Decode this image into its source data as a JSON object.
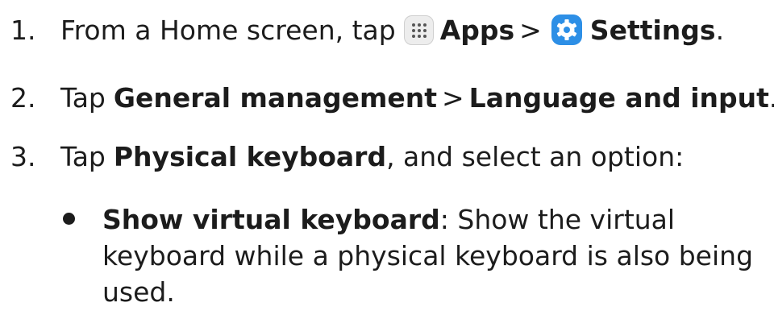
{
  "steps": [
    {
      "num": "1.",
      "prefix": "From a Home screen, tap",
      "apps_label": "Apps",
      "separator": ">",
      "settings_label": "Settings",
      "suffix": ".",
      "icons": [
        "apps-grid-icon",
        "settings-gear-icon"
      ]
    },
    {
      "num": "2.",
      "prefix": "Tap",
      "item1": "General management",
      "separator": ">",
      "item2": "Language and input",
      "suffix": "."
    },
    {
      "num": "3.",
      "prefix": "Tap",
      "item": "Physical keyboard",
      "suffix": ", and select an option:"
    }
  ],
  "bullets": [
    {
      "title": "Show virtual keyboard",
      "text": ": Show the virtual keyboard while a physical keyboard is also being used."
    }
  ],
  "colors": {
    "text": "#1c1c1c",
    "settings_icon": "#2d8fe6",
    "apps_icon_bg": "#ededed"
  }
}
